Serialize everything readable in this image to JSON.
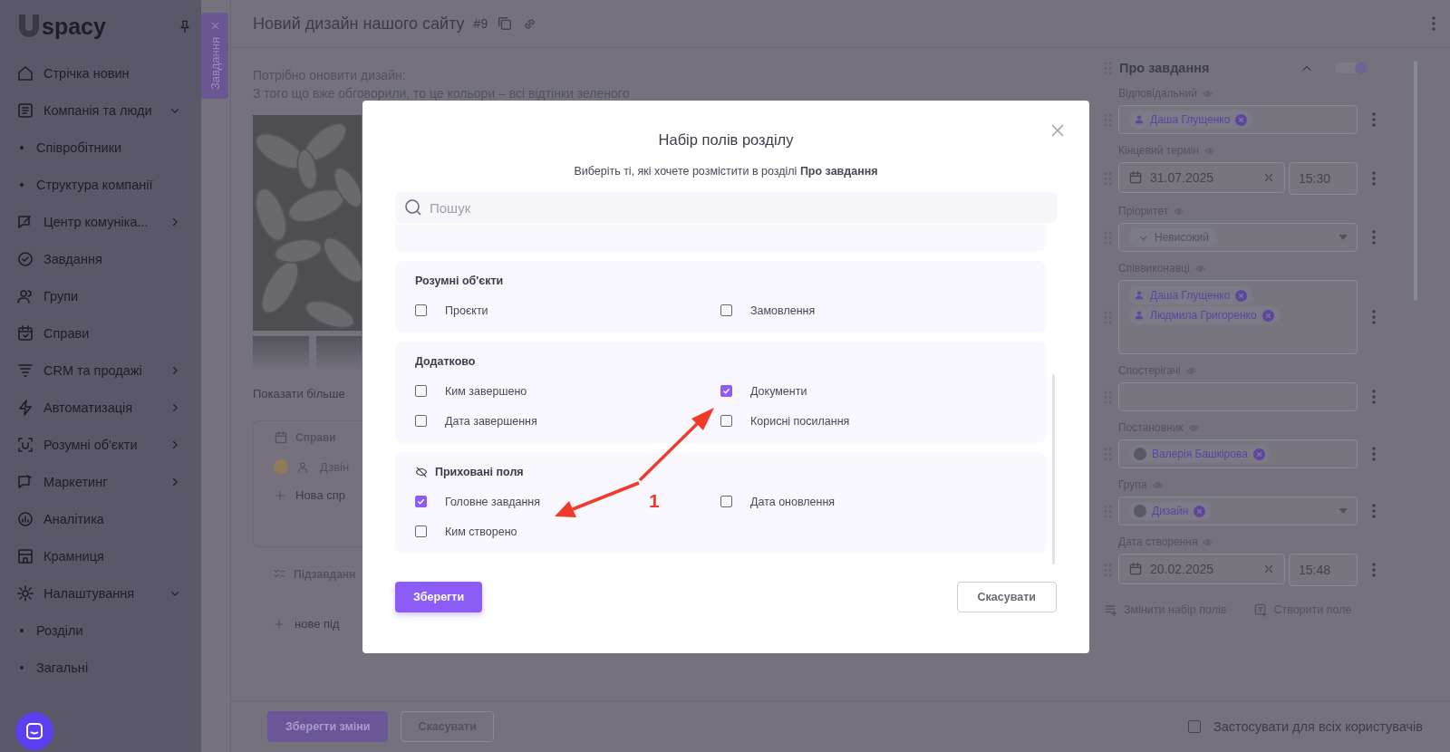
{
  "sidebar": {
    "logo": "spacy",
    "items": [
      {
        "label": "Стрічка новин"
      },
      {
        "label": "Компанія та люди",
        "expanded": true,
        "children": [
          {
            "label": "Співробітники"
          },
          {
            "label": "Структура компанії"
          }
        ]
      },
      {
        "label": "Центр комуніка...",
        "expanded": false
      },
      {
        "label": "Завдання"
      },
      {
        "label": "Групи"
      },
      {
        "label": "Справи"
      },
      {
        "label": "CRM та продажі",
        "expanded": false
      },
      {
        "label": "Автоматизація",
        "expanded": false
      },
      {
        "label": "Розумні об'єкти",
        "expanded": false
      },
      {
        "label": "Маркетинг",
        "expanded": false
      },
      {
        "label": "Аналітика"
      },
      {
        "label": "Крамниця"
      },
      {
        "label": "Налаштування",
        "expanded": true,
        "children": [
          {
            "label": "Розділи"
          },
          {
            "label": "Загальні"
          }
        ]
      }
    ]
  },
  "task_tab": {
    "label": "Завдання"
  },
  "header": {
    "title": "Новий дизайн нашого сайту",
    "number": "#9"
  },
  "description": [
    "Потрібно оновити дизайн:",
    "З того що вже обговорили, то це кольори – всі відтінки зеленого"
  ],
  "gallery": {
    "show_more": "Показати більше"
  },
  "activities": {
    "tab": "Справи",
    "item": "Дзвін",
    "add": "Нова спр"
  },
  "subtasks": {
    "title": "Підзавданн",
    "add": "нове під"
  },
  "panel": {
    "title": "Про завдання",
    "fields": [
      {
        "label": "Відповідальний",
        "kind": "people",
        "chips": [
          {
            "name": "Даша Глущенко",
            "kind": "person"
          }
        ]
      },
      {
        "label": "Кінцевий термін",
        "kind": "date",
        "date": "31.07.2025",
        "time": "15:30"
      },
      {
        "label": "Пріоритет",
        "kind": "select",
        "value": "Невисокий"
      },
      {
        "label": "Співвиконавці",
        "kind": "people",
        "chips": [
          {
            "name": "Даша Глущенко",
            "kind": "person"
          },
          {
            "name": "Людмила Григоренко",
            "kind": "person"
          }
        ]
      },
      {
        "label": "Спостерігачі",
        "kind": "people"
      },
      {
        "label": "Постановник",
        "kind": "people",
        "chips": [
          {
            "name": "Валерія Башкірова"
          }
        ]
      },
      {
        "label": "Група",
        "kind": "select",
        "chips": [
          {
            "name": "Дизайн"
          }
        ]
      },
      {
        "label": "Дата створення",
        "kind": "date",
        "date": "20.02.2025",
        "time": "15:48"
      }
    ],
    "change_fields": "Змінити набір полів",
    "create_field": "Створити поле"
  },
  "footer": {
    "save": "Зберегти зміни",
    "cancel": "Скасувати",
    "apply_all": {
      "label": "Застосувати для всіх користувачів",
      "checked": false
    }
  },
  "modal": {
    "title": "Набір полів розділу",
    "subtitle": "Виберіть ті, які хочете розмістити в розділі **Про завдання**",
    "search_placeholder": "Пошук",
    "groups": [
      {
        "title": "Розумні об'єкти",
        "hidden": false,
        "fields": [
          {
            "label": "Проєкти",
            "checked": false
          },
          {
            "label": "Замовлення",
            "checked": false
          }
        ]
      },
      {
        "title": "Додатково",
        "hidden": false,
        "fields": [
          {
            "label": "Ким завершено",
            "checked": false
          },
          {
            "label": "Документи",
            "checked": true
          },
          {
            "label": "Дата завершення",
            "checked": false
          },
          {
            "label": "Корисні посилання",
            "checked": false
          }
        ]
      },
      {
        "title": "Приховані поля",
        "hidden": true,
        "fields": [
          {
            "label": "Головне завдання",
            "checked": true
          },
          {
            "label": "Дата оновлення",
            "checked": false
          },
          {
            "label": "Ким створено",
            "checked": false
          }
        ]
      }
    ],
    "save": "Зберегти",
    "cancel": "Скасувати"
  },
  "annotation": {
    "label": "1"
  }
}
